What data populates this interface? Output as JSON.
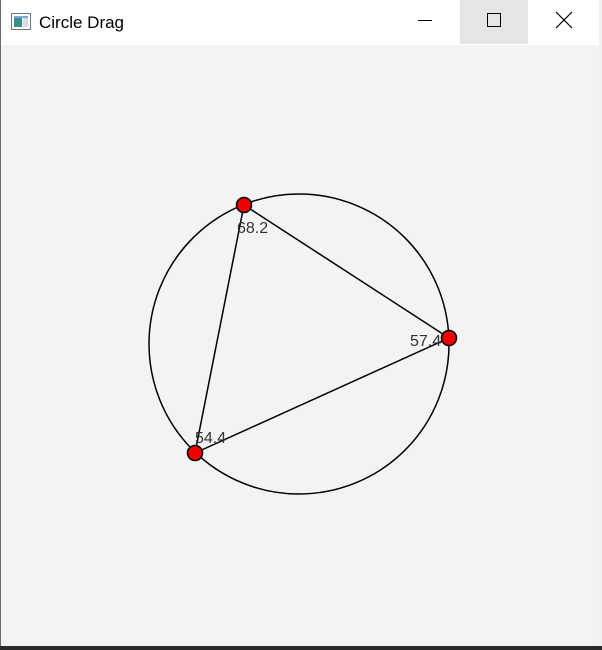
{
  "window": {
    "title": "Circle Drag",
    "controls": {
      "minimize_icon": "minimize-icon",
      "maximize_icon": "maximize-icon",
      "close_icon": "close-icon"
    }
  },
  "canvas": {
    "background": "#f3f3f3",
    "point_color": "#ee0000",
    "line_color": "#000000",
    "angle_labels": [
      "68.2",
      "57.4",
      "54.4"
    ]
  }
}
